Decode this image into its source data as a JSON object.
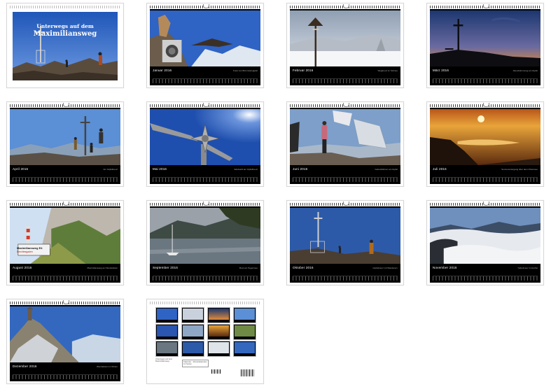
{
  "cover": {
    "title_line1": "Unterwegs auf dem",
    "title_line2": "Maximiliansweg"
  },
  "months": [
    {
      "label": "Januar 2016",
      "credit": "Kreuz am Brünnsteingipfel"
    },
    {
      "label": "Februar 2016",
      "credit": "Wegkreuz im Schnee"
    },
    {
      "label": "März 2016",
      "credit": "Abendstimmung am Gipfel"
    },
    {
      "label": "April 2016",
      "credit": "Am Gipfelkreuz"
    },
    {
      "label": "Mai 2016",
      "credit": "Edelweiß am Gipfelkreuz"
    },
    {
      "label": "Juni 2016",
      "credit": "Gebetsfahnen am Gipfel"
    },
    {
      "label": "Juli 2016",
      "credit": "Sonnenuntergang über dem Chiemsee"
    },
    {
      "label": "August 2016",
      "credit": "Maximiliansweg am Wendelstein"
    },
    {
      "label": "September 2016",
      "credit": "Boot am Tegernsee"
    },
    {
      "label": "Oktober 2016",
      "credit": "Gipfelkreuz mit Wanderern"
    },
    {
      "label": "November 2016",
      "credit": "Nebelmeer im Herbst"
    },
    {
      "label": "Dezember 2016",
      "credit": "Wendelstein im Winter"
    }
  ],
  "sign": {
    "line1": "Maximiliansweg E4",
    "line2": "Berchtesgaden"
  },
  "back": {
    "caption": "Unterwegs auf dem Maximiliansweg",
    "info": "Kalender · Monatskalender 14 Seiten"
  },
  "colors": {
    "sky_blue": "#2d5aa8",
    "sunset": "#d9822b",
    "dark": "#0b0b0b"
  }
}
